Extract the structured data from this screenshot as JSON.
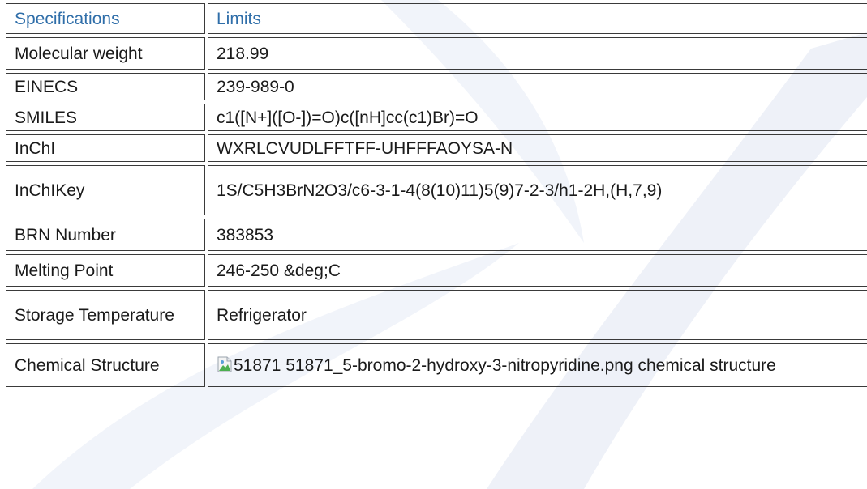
{
  "header": {
    "specifications": "Specifications",
    "limits": "Limits"
  },
  "rows": [
    {
      "label": "Molecular weight",
      "value": "218.99"
    },
    {
      "label": "EINECS",
      "value": "239-989-0"
    },
    {
      "label": "SMILES",
      "value": "c1([N+]([O-])=O)c([nH]cc(c1)Br)=O"
    },
    {
      "label": "InChI",
      "value": "WXRLCVUDLFFTFF-UHFFFAOYSA-N"
    },
    {
      "label": "InChIKey",
      "value": "1S/C5H3BrN2O3/c6-3-1-4(8(10)11)5(9)7-2-3/h1-2H,(H,7,9)"
    },
    {
      "label": "BRN Number",
      "value": "383853"
    },
    {
      "label": "Melting Point",
      "value": "246-250 &deg;C"
    },
    {
      "label": "Storage Temperature",
      "value": "Refrigerator"
    },
    {
      "label": "Chemical Structure",
      "value": "51871 51871_5-bromo-2-hydroxy-3-nitropyridine.png chemical structure"
    }
  ],
  "colors": {
    "header_text": "#2f6ea9",
    "border": "#3a3a3a",
    "watermark": "#eef1f8"
  },
  "icons": {
    "broken_image": "broken-image-icon"
  }
}
